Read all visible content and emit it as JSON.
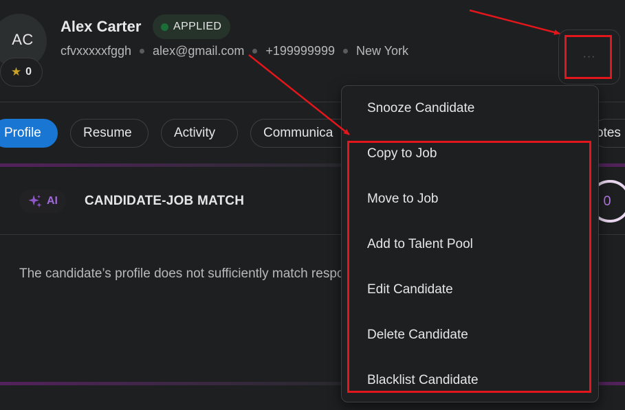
{
  "candidate": {
    "initials": "AC",
    "rating": "0",
    "name": "Alex Carter",
    "status": "APPLIED",
    "username": "cfvxxxxxfggh",
    "email": "alex@gmail.com",
    "phone": "+199999999",
    "location": "New York"
  },
  "more_button": {
    "label": "···"
  },
  "tabs": [
    {
      "label": "Profile",
      "active": true
    },
    {
      "label": "Resume",
      "active": false
    },
    {
      "label": "Activity",
      "active": false
    },
    {
      "label": "Communica",
      "active": false
    },
    {
      "label": "otes",
      "active": false
    }
  ],
  "match": {
    "ai_label": "AI",
    "title": "CANDIDATE-JOB MATCH",
    "score": "0",
    "description": "The candidate’s profile does not sufficiently match responsibilities."
  },
  "menu": {
    "items": [
      "Snooze Candidate",
      "Copy to Job",
      "Move to Job",
      "Add to Talent Pool",
      "Edit Candidate",
      "Delete Candidate",
      "Blacklist Candidate"
    ]
  },
  "colors": {
    "background": "#1e1f21",
    "accent_blue": "#1976d2",
    "annotation_red": "#e3161b",
    "ai_purple": "#a06ad8",
    "status_green": "#1b6e36"
  },
  "icons": [
    "star-icon",
    "sparkle-icon",
    "more-icon"
  ]
}
